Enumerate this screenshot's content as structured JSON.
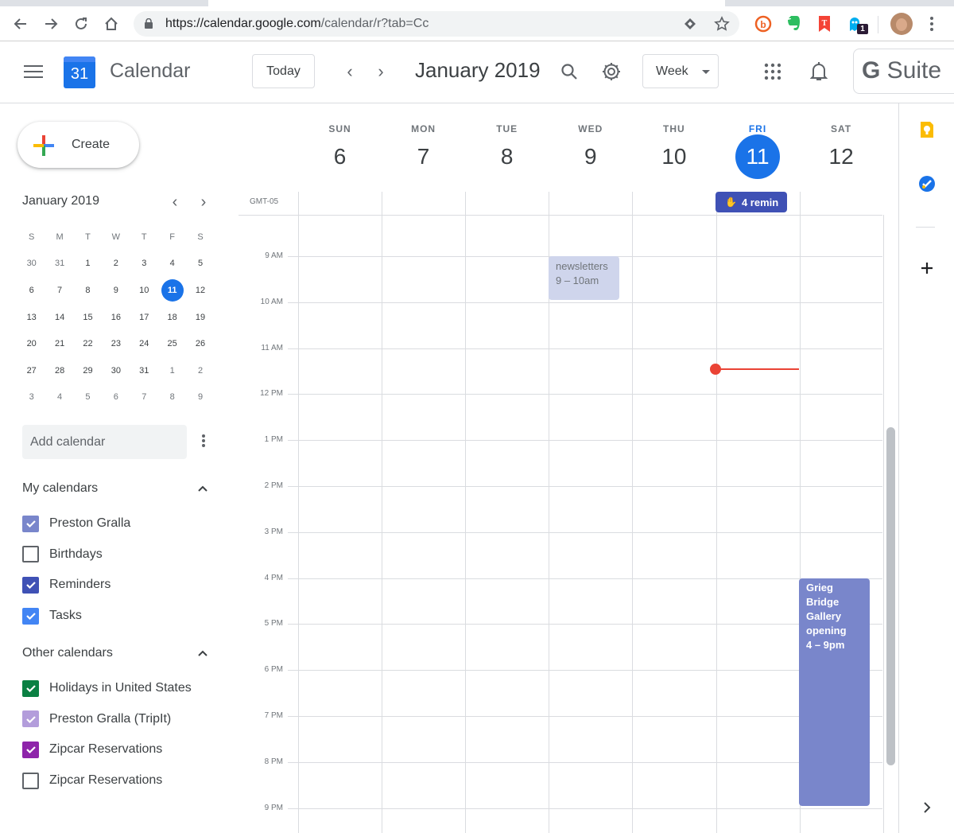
{
  "browser": {
    "url_domain": "https://calendar.google.com",
    "url_path": "/calendar/r?tab=Cc",
    "extension_badge": "1",
    "nav_icons": [
      "back-arrow-icon",
      "forward-arrow-icon",
      "reload-icon",
      "home-icon"
    ],
    "extensions": [
      "bitly-icon",
      "evernote-icon",
      "nytimes-icon",
      "ghostery-icon"
    ]
  },
  "header": {
    "app_title": "Calendar",
    "logo_day": "31",
    "today_label": "Today",
    "date_title": "January 2019",
    "view_label": "Week",
    "gsuite_g": "G",
    "gsuite_label": " Suite"
  },
  "sidebar": {
    "create_label": "Create",
    "mini_calendar": {
      "title": "January 2019",
      "weekdays": [
        "S",
        "M",
        "T",
        "W",
        "T",
        "F",
        "S"
      ],
      "weeks": [
        [
          "30",
          "31",
          "1",
          "2",
          "3",
          "4",
          "5"
        ],
        [
          "6",
          "7",
          "8",
          "9",
          "10",
          "11",
          "12"
        ],
        [
          "13",
          "14",
          "15",
          "16",
          "17",
          "18",
          "19"
        ],
        [
          "20",
          "21",
          "22",
          "23",
          "24",
          "25",
          "26"
        ],
        [
          "27",
          "28",
          "29",
          "30",
          "31",
          "1",
          "2"
        ],
        [
          "3",
          "4",
          "5",
          "6",
          "7",
          "8",
          "9"
        ]
      ],
      "today": "11"
    },
    "add_calendar_placeholder": "Add calendar",
    "my_calendars": {
      "title": "My calendars",
      "items": [
        {
          "label": "Preston Gralla",
          "checked": true,
          "color": "#7986cb"
        },
        {
          "label": "Birthdays",
          "checked": false,
          "color": "#5f6368"
        },
        {
          "label": "Reminders",
          "checked": true,
          "color": "#3f51b5"
        },
        {
          "label": "Tasks",
          "checked": true,
          "color": "#4285f4"
        }
      ]
    },
    "other_calendars": {
      "title": "Other calendars",
      "items": [
        {
          "label": "Holidays in United States",
          "checked": true,
          "color": "#0b8043"
        },
        {
          "label": "Preston Gralla (TripIt)",
          "checked": true,
          "color": "#b39ddb"
        },
        {
          "label": "Zipcar Reservations",
          "checked": true,
          "color": "#8e24aa"
        },
        {
          "label": "Zipcar Reservations",
          "checked": false,
          "color": "#5f6368"
        }
      ]
    }
  },
  "week": {
    "timezone": "GMT-05",
    "days": [
      {
        "name": "SUN",
        "date": "6"
      },
      {
        "name": "MON",
        "date": "7"
      },
      {
        "name": "TUE",
        "date": "8"
      },
      {
        "name": "WED",
        "date": "9"
      },
      {
        "name": "THU",
        "date": "10"
      },
      {
        "name": "FRI",
        "date": "11",
        "today": true
      },
      {
        "name": "SAT",
        "date": "12"
      }
    ],
    "hours": [
      "9 AM",
      "10 AM",
      "11 AM",
      "12 PM",
      "1 PM",
      "2 PM",
      "3 PM",
      "4 PM",
      "5 PM",
      "6 PM",
      "7 PM",
      "8 PM",
      "9 PM"
    ],
    "allday_reminder": {
      "label": "4 remin",
      "day": "FRI"
    },
    "events": [
      {
        "title": "newsletters",
        "time": "9 – 10am",
        "day": "WED",
        "color": "#cfd5ec"
      },
      {
        "title": "Grieg Bridge Gallery opening",
        "time": "4 – 9pm",
        "day": "SAT",
        "color": "#7986cb"
      }
    ],
    "current_time_marker_color": "#ea4335"
  },
  "colors": {
    "accent": "#1a73e8",
    "reminder": "#3f51b5"
  }
}
